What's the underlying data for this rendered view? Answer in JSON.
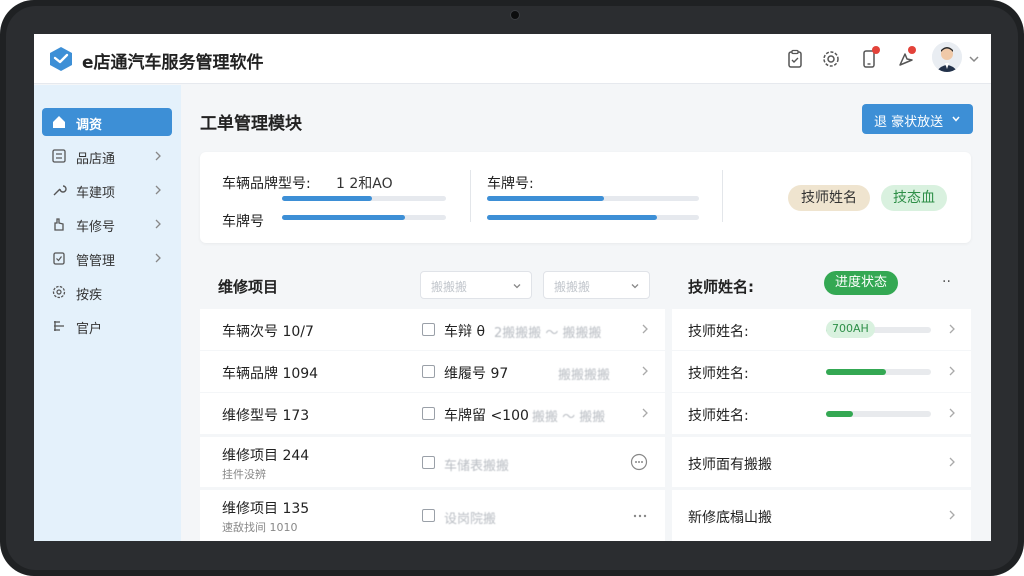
{
  "app": {
    "title": "e店通汽车服务管理软件",
    "colors": {
      "primary": "#3d8fd6",
      "success": "#34a853",
      "sidebar": "#e4f1fb",
      "badge": "#e3423a"
    }
  },
  "header": {
    "icons": [
      "clipboard-icon",
      "gear-icon",
      "phone-icon",
      "cursor-icon",
      "user-avatar"
    ]
  },
  "sidebar": {
    "items": [
      {
        "label": "调资",
        "icon": "home-icon",
        "active": true
      },
      {
        "label": "品店通",
        "icon": "list-icon",
        "active": false
      },
      {
        "label": "车建项",
        "icon": "wrench-icon",
        "active": false
      },
      {
        "label": "车修号",
        "icon": "hand-icon",
        "active": false
      },
      {
        "label": "管管理",
        "icon": "clipboard-check-icon",
        "active": false
      },
      {
        "label": "按疾",
        "icon": "settings-icon",
        "active": false
      },
      {
        "label": "官户",
        "icon": "user-grid-icon",
        "active": false
      }
    ]
  },
  "main": {
    "title": "工单管理模块",
    "primary_button": "退 豪状放送",
    "summary": {
      "field1_label": "车辆品牌型号:",
      "field1_value": "1 2和AO",
      "field2_label": "车牌号",
      "field3_label": "车牌号:",
      "pill_tech": "技师姓名",
      "pill_status": "技态血",
      "progress": [
        0.55,
        0.75,
        0.55,
        0.8
      ]
    },
    "repair": {
      "title": "维修项目",
      "dropdown1": "搬搬搬",
      "dropdown2": "搬搬搬",
      "rows": [
        {
          "title": "车辆次号 10/7",
          "sub": "",
          "field": "车辩 θ",
          "muted": "2搬搬搬 ～ 搬搬搬"
        },
        {
          "title": "车辆品牌 1094",
          "sub": "",
          "field": "维履号 97",
          "muted": "搬搬搬搬"
        },
        {
          "title": "维修型号 173",
          "sub": "",
          "field": "车牌留 <100",
          "muted": "搬搬 ～ 搬搬"
        },
        {
          "title": "维修项目 244",
          "sub": "挂件没辨",
          "field": "",
          "muted": "车储表搬搬"
        },
        {
          "title": "维修项目 135",
          "sub": "速敌找间 1010",
          "field": "",
          "muted": "设岗院搬"
        }
      ]
    },
    "tech": {
      "title": "技师姓名:",
      "status_pill": "进度状态",
      "more": "··",
      "rows": [
        {
          "label": "技师姓名:",
          "progress": 0.22,
          "progress_text": "700AH"
        },
        {
          "label": "技师姓名:",
          "progress": 0.57,
          "progress_text": ""
        },
        {
          "label": "技师姓名:",
          "progress": 0.26,
          "progress_text": ""
        },
        {
          "label": "技师面有搬搬",
          "progress": null,
          "progress_text": ""
        },
        {
          "label": "新修底榻山搬",
          "progress": null,
          "progress_text": ""
        }
      ]
    }
  }
}
